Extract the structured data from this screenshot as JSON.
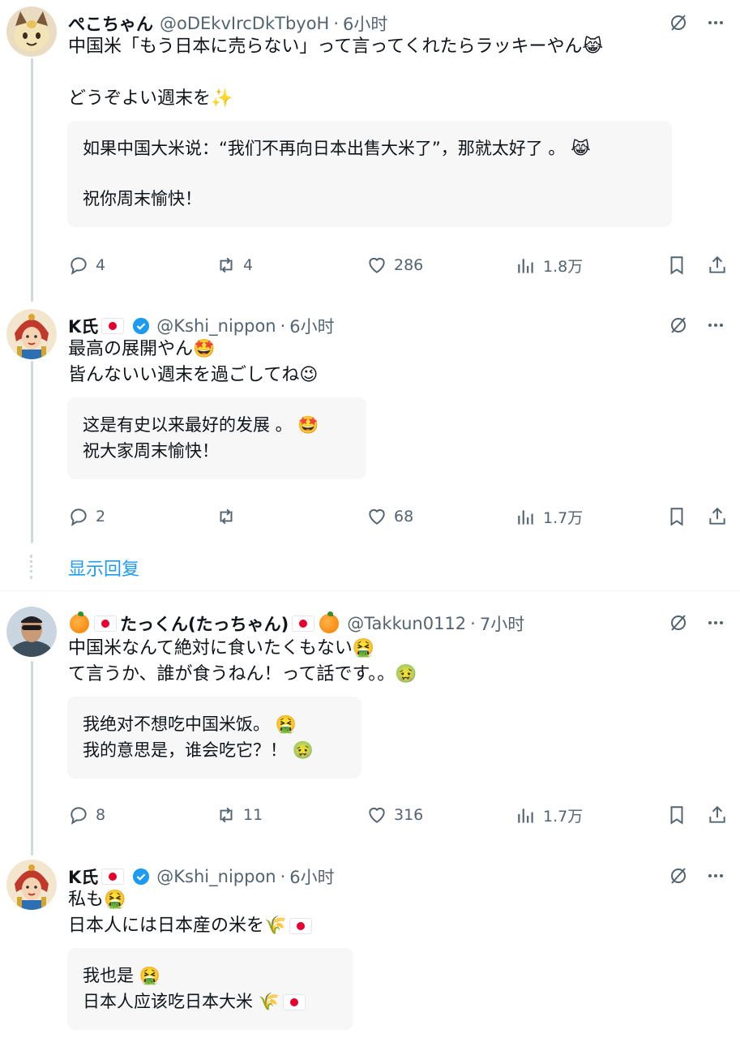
{
  "posts": [
    {
      "name": "ぺこちゃん",
      "handle": "@oDEkvIrcDkTbyoH",
      "sep": "·",
      "time": "6小时",
      "lines": [
        "中国米「もう日本に売らない」って言ってくれたらラッキーやん😹",
        "",
        "どうぞよい週末を✨"
      ],
      "translation": [
        "如果中国大米说：“我们不再向日本出售大米了”，那就太好了 。 😹",
        "",
        "祝你周末愉快！"
      ],
      "stats": {
        "replies": "4",
        "reposts": "4",
        "likes": "286",
        "views": "1.8万"
      }
    },
    {
      "name": "K氏",
      "handle": "@Kshi_nippon",
      "sep": "·",
      "time": "6小时",
      "lines": [
        "最高の展開やん🤩",
        "皆んないい週末を過ごしてね😉"
      ],
      "translation": [
        "这是有史以来最好的发展 。 🤩",
        "祝大家周末愉快！"
      ],
      "stats": {
        "replies": "2",
        "reposts": "",
        "likes": "68",
        "views": "1.7万"
      }
    },
    {
      "name": "たっくん(たっちゃん)",
      "handle": "@Takkun0112",
      "sep": "·",
      "time": "7小时",
      "lines": [
        "中国米なんて絶対に食いたくもない🤮",
        "て言うか、誰が食うねん！って話です。。🤢"
      ],
      "translation": [
        "我绝对不想吃中国米饭。 🤮",
        "我的意思是，谁会吃它？！ 🤢"
      ],
      "stats": {
        "replies": "8",
        "reposts": "11",
        "likes": "316",
        "views": "1.7万"
      }
    },
    {
      "name": "K氏",
      "handle": "@Kshi_nippon",
      "sep": "·",
      "time": "6小时",
      "lines": [
        "私も🤮",
        "日本人には日本産の米を🌾"
      ],
      "translation": [
        "我也是 🤮",
        "日本人应该吃日本大米 🌾"
      ]
    }
  ],
  "show_replies": "显示回复",
  "colors": {
    "link": "#1d9bf0",
    "muted": "#536471",
    "translation_bg": "#f7f7f7",
    "verified": "#1d9bf0"
  }
}
